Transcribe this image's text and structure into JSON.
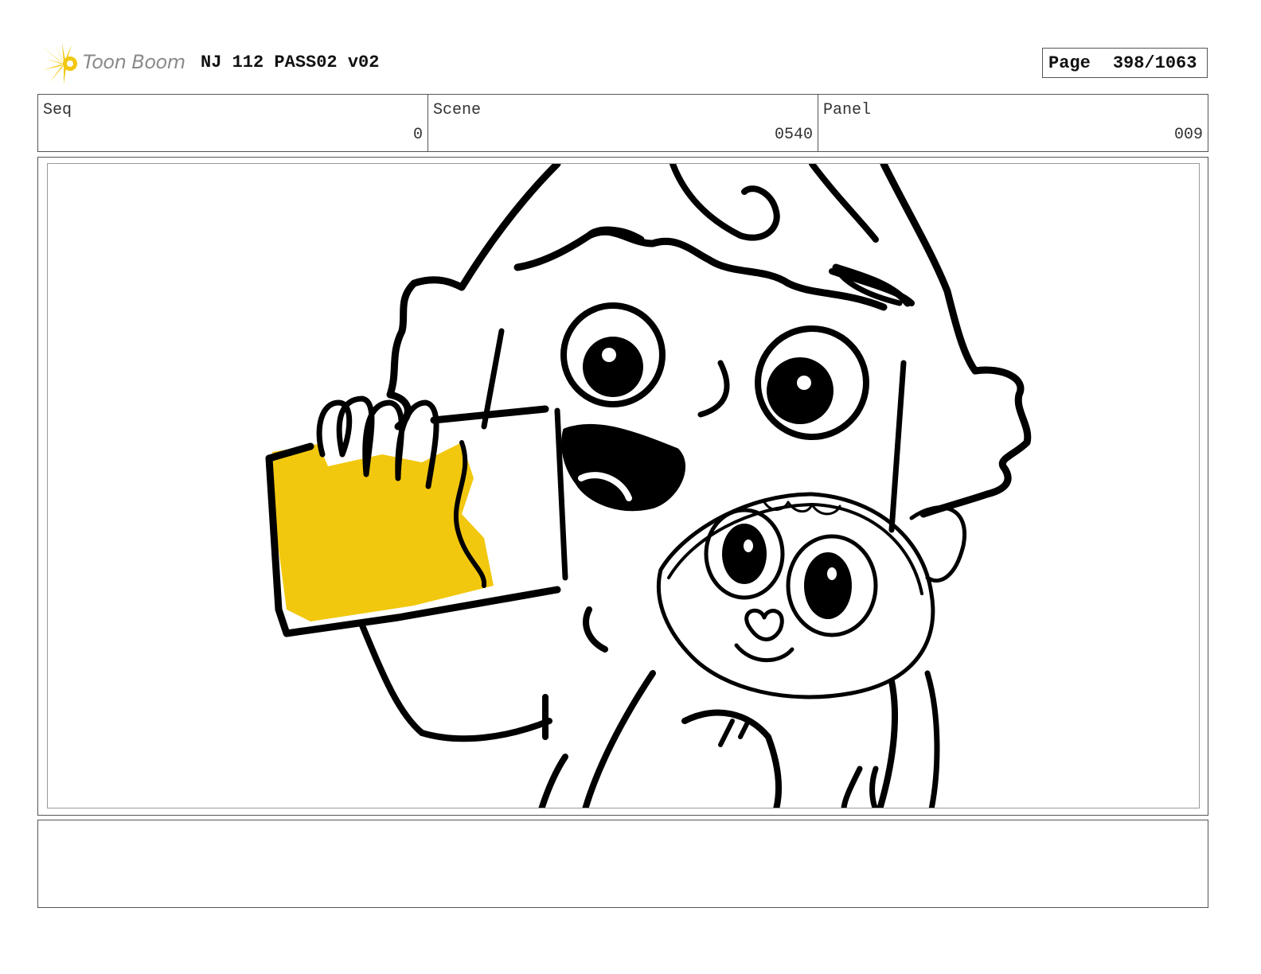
{
  "header": {
    "logo_text": "Toon Boom",
    "title": "NJ 112 PASS02 v02",
    "page_label": "Page",
    "page_value": "398/1063"
  },
  "info": {
    "seq": {
      "label": "Seq",
      "value": "0"
    },
    "scene": {
      "label": "Scene",
      "value": "0540"
    },
    "panel": {
      "label": "Panel",
      "value": "009"
    }
  },
  "drawing": {
    "description_icon": "storyboard-sketch",
    "accent_color": "#f2c80f",
    "line_color": "#000000"
  },
  "notes": {
    "text": ""
  }
}
